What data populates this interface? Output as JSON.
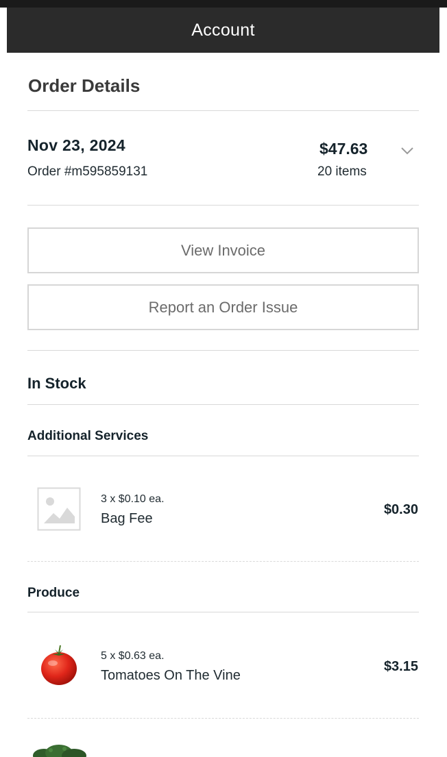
{
  "header": {
    "title": "Account"
  },
  "page": {
    "title": "Order Details"
  },
  "order": {
    "date": "Nov 23, 2024",
    "number": "Order #m595859131",
    "total": "$47.63",
    "items_count": "20 items"
  },
  "actions": {
    "view_invoice": "View Invoice",
    "report_issue": "Report an Order Issue"
  },
  "sections": {
    "in_stock": "In Stock",
    "additional_services": "Additional Services",
    "produce": "Produce"
  },
  "items": [
    {
      "qty_price": "3 x $0.10 ea.",
      "name": "Bag Fee",
      "price": "$0.30",
      "image": "placeholder-image-icon"
    },
    {
      "qty_price": "5 x $0.63 ea.",
      "name": "Tomatoes On The Vine",
      "price": "$3.15",
      "image": "tomato-image"
    },
    {
      "image": "broccoli-image"
    }
  ],
  "colors": {
    "header_bg": "#2b2b2b",
    "text_dark": "#15232b",
    "button_border": "#d6d6d6"
  }
}
